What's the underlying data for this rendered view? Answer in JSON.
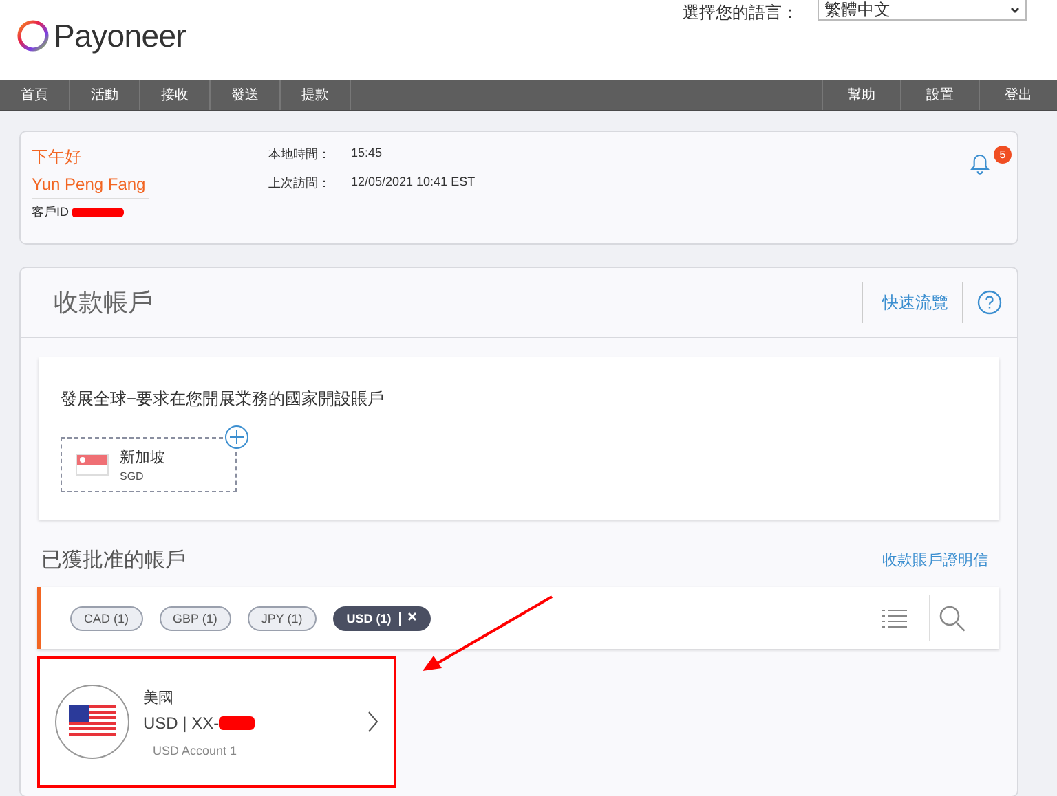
{
  "header": {
    "logo": "Payoneer",
    "language_label": "選擇您的語言：",
    "language_value": "繁體中文"
  },
  "nav": {
    "left": [
      "首頁",
      "活動",
      "接收",
      "發送",
      "提款"
    ],
    "right": [
      "幫助",
      "設置",
      "登出"
    ]
  },
  "welcome": {
    "greeting": "下午好",
    "name": "Yun Peng Fang",
    "customer_id_label": "客戶ID",
    "local_time_label": "本地時間：",
    "local_time": "15:45",
    "last_visit_label": "上次訪問：",
    "last_visit": "12/05/2021 10:41 EST",
    "notifications": "5"
  },
  "receiving": {
    "title": "收款帳戶",
    "quick_tour": "快速流覽",
    "promo": {
      "text": "發展全球−要求在您開展業務的國家開設賬戶",
      "currencies": [
        {
          "country": "新加坡",
          "code": "SGD"
        }
      ]
    },
    "approved_title": "已獲批准的帳戶",
    "letter_link": "收款賬戶證明信",
    "filters": [
      {
        "label": "CAD (1)",
        "selected": false
      },
      {
        "label": "GBP (1)",
        "selected": false
      },
      {
        "label": "JPY (1)",
        "selected": false
      },
      {
        "label": "USD (1)",
        "selected": true
      }
    ],
    "accounts": [
      {
        "country": "美國",
        "number": "USD | XX-",
        "nickname": "USD Account 1"
      }
    ]
  }
}
